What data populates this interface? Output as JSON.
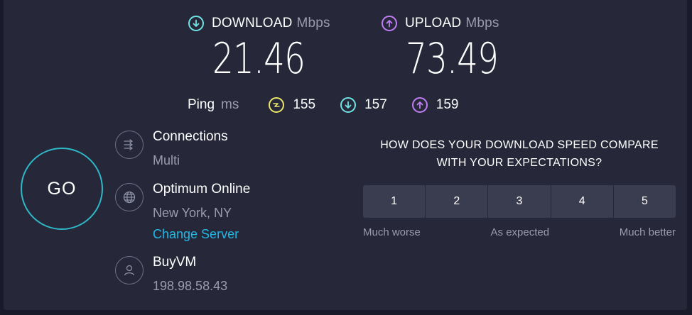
{
  "download": {
    "label": "DOWNLOAD",
    "unit": "Mbps",
    "value": "21.46",
    "icon": "arrow-down-circle-icon"
  },
  "upload": {
    "label": "UPLOAD",
    "unit": "Mbps",
    "value": "73.49",
    "icon": "arrow-up-circle-icon"
  },
  "ping": {
    "label": "Ping",
    "unit": "ms",
    "idle": "155",
    "download": "157",
    "upload": "159"
  },
  "go_button": {
    "label": "GO"
  },
  "connections": {
    "title": "Connections",
    "value": "Multi"
  },
  "server": {
    "title": "Optimum Online",
    "location": "New York, NY",
    "change_link": "Change Server"
  },
  "host": {
    "title": "BuyVM",
    "ip": "198.98.58.43"
  },
  "survey": {
    "question_line1": "HOW DOES YOUR DOWNLOAD SPEED COMPARE",
    "question_line2": "WITH YOUR EXPECTATIONS?",
    "options": [
      "1",
      "2",
      "3",
      "4",
      "5"
    ],
    "label_low": "Much worse",
    "label_mid": "As expected",
    "label_high": "Much better"
  },
  "colors": {
    "background": "#262839",
    "download_accent": "#6fe3e3",
    "upload_accent": "#c07ef5",
    "ping_accent": "#ebe66a",
    "go_ring": "#2fb8c8",
    "link": "#1fb8e6"
  }
}
